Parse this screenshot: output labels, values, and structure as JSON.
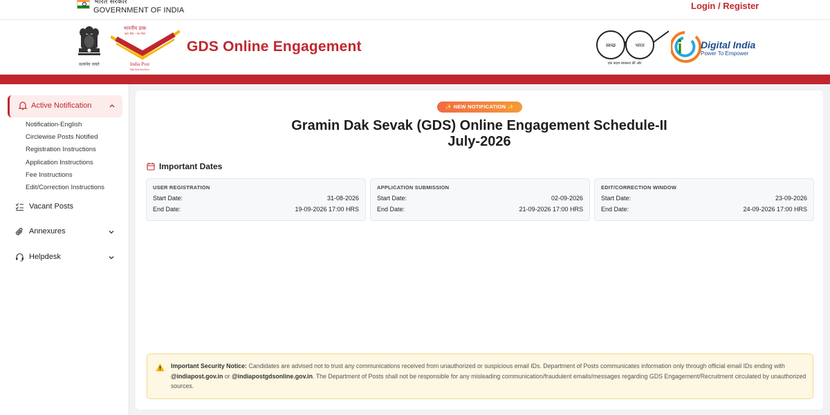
{
  "topbar": {
    "gov_hindi": "भारत सरकार",
    "gov_english": "GOVERNMENT OF INDIA",
    "login_label": "Login / Register"
  },
  "header": {
    "site_title": "GDS Online Engagement",
    "emblem_caption": "सत्यमेव जयते",
    "india_post": {
      "hindi": "भारतीय डाक",
      "hindi_tagline": "डाक सेवा - जन सेवा",
      "english": "India Post",
      "tagline": "Dak Seva Jan Seva"
    },
    "swachh_bharat": {
      "left_word": "स्वच्छ",
      "right_word": "भारत",
      "caption": "एक कदम स्वच्छता की ओर"
    },
    "digital_india": {
      "name": "Digital India",
      "tagline": "Power To Empower"
    }
  },
  "sidebar": {
    "active_item": {
      "label": "Active Notification",
      "icon": "bell-icon",
      "subitems": [
        "Notification-English",
        "Circlewise Posts Notified",
        "Registration Instructions",
        "Application Instructions",
        "Fee Instructions",
        "Edit/Correction Instructions"
      ]
    },
    "items": [
      {
        "label": "Vacant Posts",
        "icon": "list-icon"
      },
      {
        "label": "Annexures",
        "icon": "paperclip-icon"
      },
      {
        "label": "Helpdesk",
        "icon": "headset-icon"
      }
    ]
  },
  "main": {
    "badge": "✨ NEW NOTIFICATION ✨",
    "title_line1": "Gramin Dak Sevak (GDS) Online Engagement Schedule-II",
    "title_line2": "July-2026",
    "dates_heading": "Important Dates",
    "date_cards": [
      {
        "title": "USER REGISTRATION",
        "start_label": "Start Date:",
        "start": "31-08-2026",
        "end_label": "End Date:",
        "end": "19-09-2026 17:00 HRS"
      },
      {
        "title": "APPLICATION SUBMISSION",
        "start_label": "Start Date:",
        "start": "02-09-2026",
        "end_label": "End Date:",
        "end": "21-09-2026 17:00 HRS"
      },
      {
        "title": "EDIT/CORRECTION WINDOW",
        "start_label": "Start Date:",
        "start": "23-09-2026",
        "end_label": "End Date:",
        "end": "24-09-2026 17:00 HRS"
      }
    ],
    "notice": {
      "heading": "Important Security Notice:",
      "text1": " Candidates are advised not to trust any communications received from unauthorized or suspicious email IDs. Department of Posts communicates information only through official email IDs ending with ",
      "domain1": "@indiapost.gov.in",
      "text2": " or ",
      "domain2": "@indiapostgdsonline.gov.in",
      "text3": ". The Department of Posts shall not be responsible for any misleading communication/fraudulent emails/messages regarding GDS Engagement/Recruitment circulated by unauthorized sources."
    }
  },
  "colors": {
    "brand_red": "#c0272d",
    "badge_orange": "#f26a45",
    "notice_bg": "#fdf7e3"
  }
}
